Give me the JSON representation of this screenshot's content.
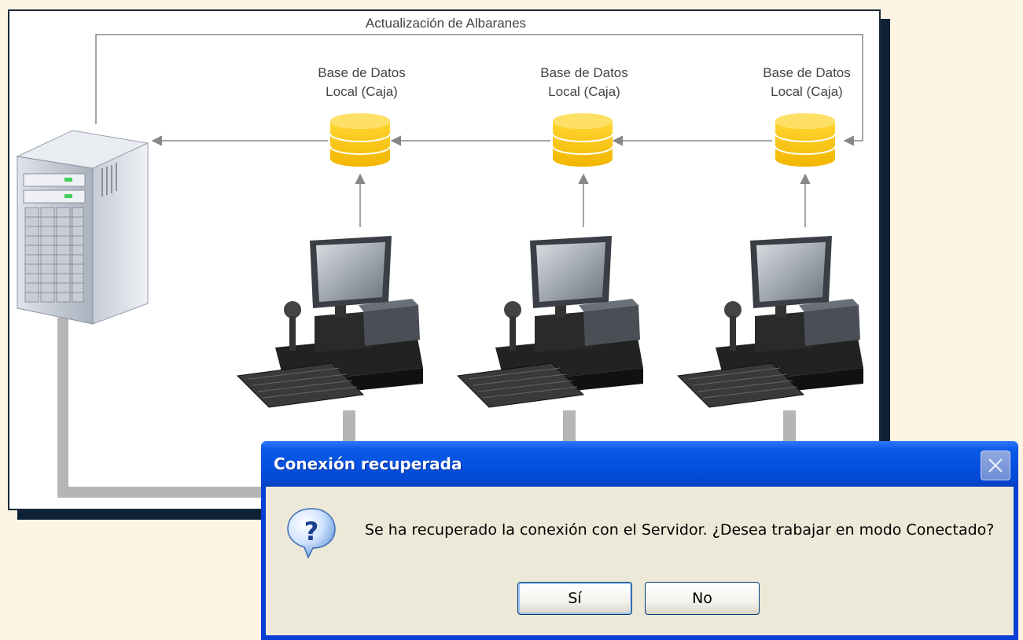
{
  "diagram": {
    "top_label": "Actualización de Albaranes",
    "databases": [
      {
        "line1": "Base de Datos",
        "line2": "Local (Caja)"
      },
      {
        "line1": "Base de Datos",
        "line2": "Local (Caja)"
      },
      {
        "line1": "Base de Datos",
        "line2": "Local (Caja)"
      }
    ],
    "colors": {
      "database": "#f7c400",
      "arrows": "#888888",
      "cable": "#b5b5b5"
    }
  },
  "dialog": {
    "title": "Conexión recuperada",
    "message": "Se ha recuperado la conexión con el Servidor. ¿Desea trabajar en modo Conectado?",
    "yes_label": "Sí",
    "no_label": "No",
    "icon": "question-icon"
  }
}
